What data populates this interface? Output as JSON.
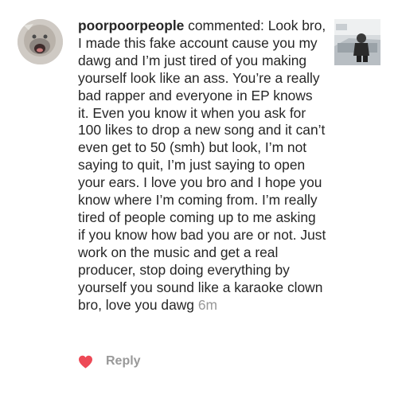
{
  "comment": {
    "username": "poorpoorpeople",
    "action": "commented:",
    "text": "Look bro, I made this fake account cause you my dawg and I’m just tired of you making yourself look like an ass. You’re a really bad rapper and everyone in EP knows it. Even you know it when you ask for 100 likes to drop a new song and it can’t even get to 50 (smh) but look, I’m not saying to quit, I’m just saying to open your ears. I love you bro and I hope you know where I’m coming from. I’m really tired of people coming up to me asking if you know how bad you are or not. Just work on the music and get a real producer, stop doing everything by yourself you sound like a karaoke clown bro, love you dawg",
    "timestamp": "6m"
  },
  "actions": {
    "like_icon": "heart-icon",
    "like_color": "#ed4956",
    "reply_label": "Reply"
  },
  "colors": {
    "text": "#262626",
    "muted": "#999999",
    "background": "#ffffff"
  }
}
